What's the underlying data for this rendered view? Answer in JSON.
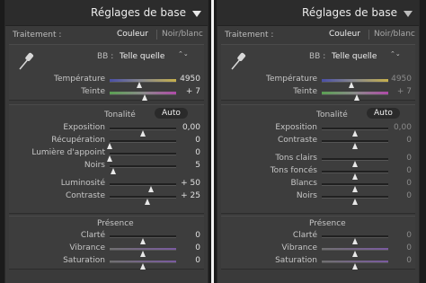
{
  "left": {
    "title": "Réglages de base",
    "treatment_label": "Traitement :",
    "opt_color": "Couleur",
    "opt_bw": "Noir/blanc",
    "bb_label": "BB :",
    "bb_value": "Telle quelle",
    "bb_arrows": "⌃⌄",
    "temperature": {
      "label": "Température",
      "value": "4950",
      "position": 0.45
    },
    "tint": {
      "label": "Teinte",
      "value": "+ 7",
      "position": 0.53
    },
    "tone_label": "Tonalité",
    "auto_label": "Auto",
    "tone_rows": [
      {
        "label": "Exposition",
        "value": "0,00",
        "position": 0.5
      },
      {
        "label": "Récupération",
        "value": "0",
        "position": 0.0
      },
      {
        "label": "Lumière d'appoint",
        "value": "0",
        "position": 0.0
      },
      {
        "label": "Noirs",
        "value": "5",
        "position": 0.05
      },
      {
        "label": "Luminosité",
        "value": "+ 50",
        "position": 0.62
      },
      {
        "label": "Contraste",
        "value": "+ 25",
        "position": 0.57
      }
    ],
    "presence_label": "Présence",
    "presence_rows": [
      {
        "label": "Clarté",
        "value": "0",
        "position": 0.5
      },
      {
        "label": "Vibrance",
        "value": "0",
        "position": 0.5
      },
      {
        "label": "Saturation",
        "value": "0",
        "position": 0.5
      }
    ]
  },
  "right": {
    "title": "Réglages de base",
    "treatment_label": "Traitement :",
    "opt_color": "Couleur",
    "opt_bw": "Noir/blanc",
    "bb_label": "BB :",
    "bb_value": "Telle quelle",
    "bb_arrows": "⌃⌄",
    "temperature": {
      "label": "Température",
      "value": "4950",
      "position": 0.45
    },
    "tint": {
      "label": "Teinte",
      "value": "+ 7",
      "position": 0.53
    },
    "tone_label": "Tonalité",
    "auto_label": "Auto",
    "tone_rows": [
      {
        "label": "Exposition",
        "value": "0,00",
        "position": 0.5
      },
      {
        "label": "Contraste",
        "value": "0",
        "position": 0.5
      },
      {
        "label": "Tons clairs",
        "value": "0",
        "position": 0.5
      },
      {
        "label": "Tons foncés",
        "value": "0",
        "position": 0.5
      },
      {
        "label": "Blancs",
        "value": "0",
        "position": 0.5
      },
      {
        "label": "Noirs",
        "value": "0",
        "position": 0.5
      }
    ],
    "presence_label": "Présence",
    "presence_rows": [
      {
        "label": "Clarté",
        "value": "0",
        "position": 0.5
      },
      {
        "label": "Vibrance",
        "value": "0",
        "position": 0.5
      },
      {
        "label": "Saturation",
        "value": "0",
        "position": 0.5
      }
    ]
  }
}
